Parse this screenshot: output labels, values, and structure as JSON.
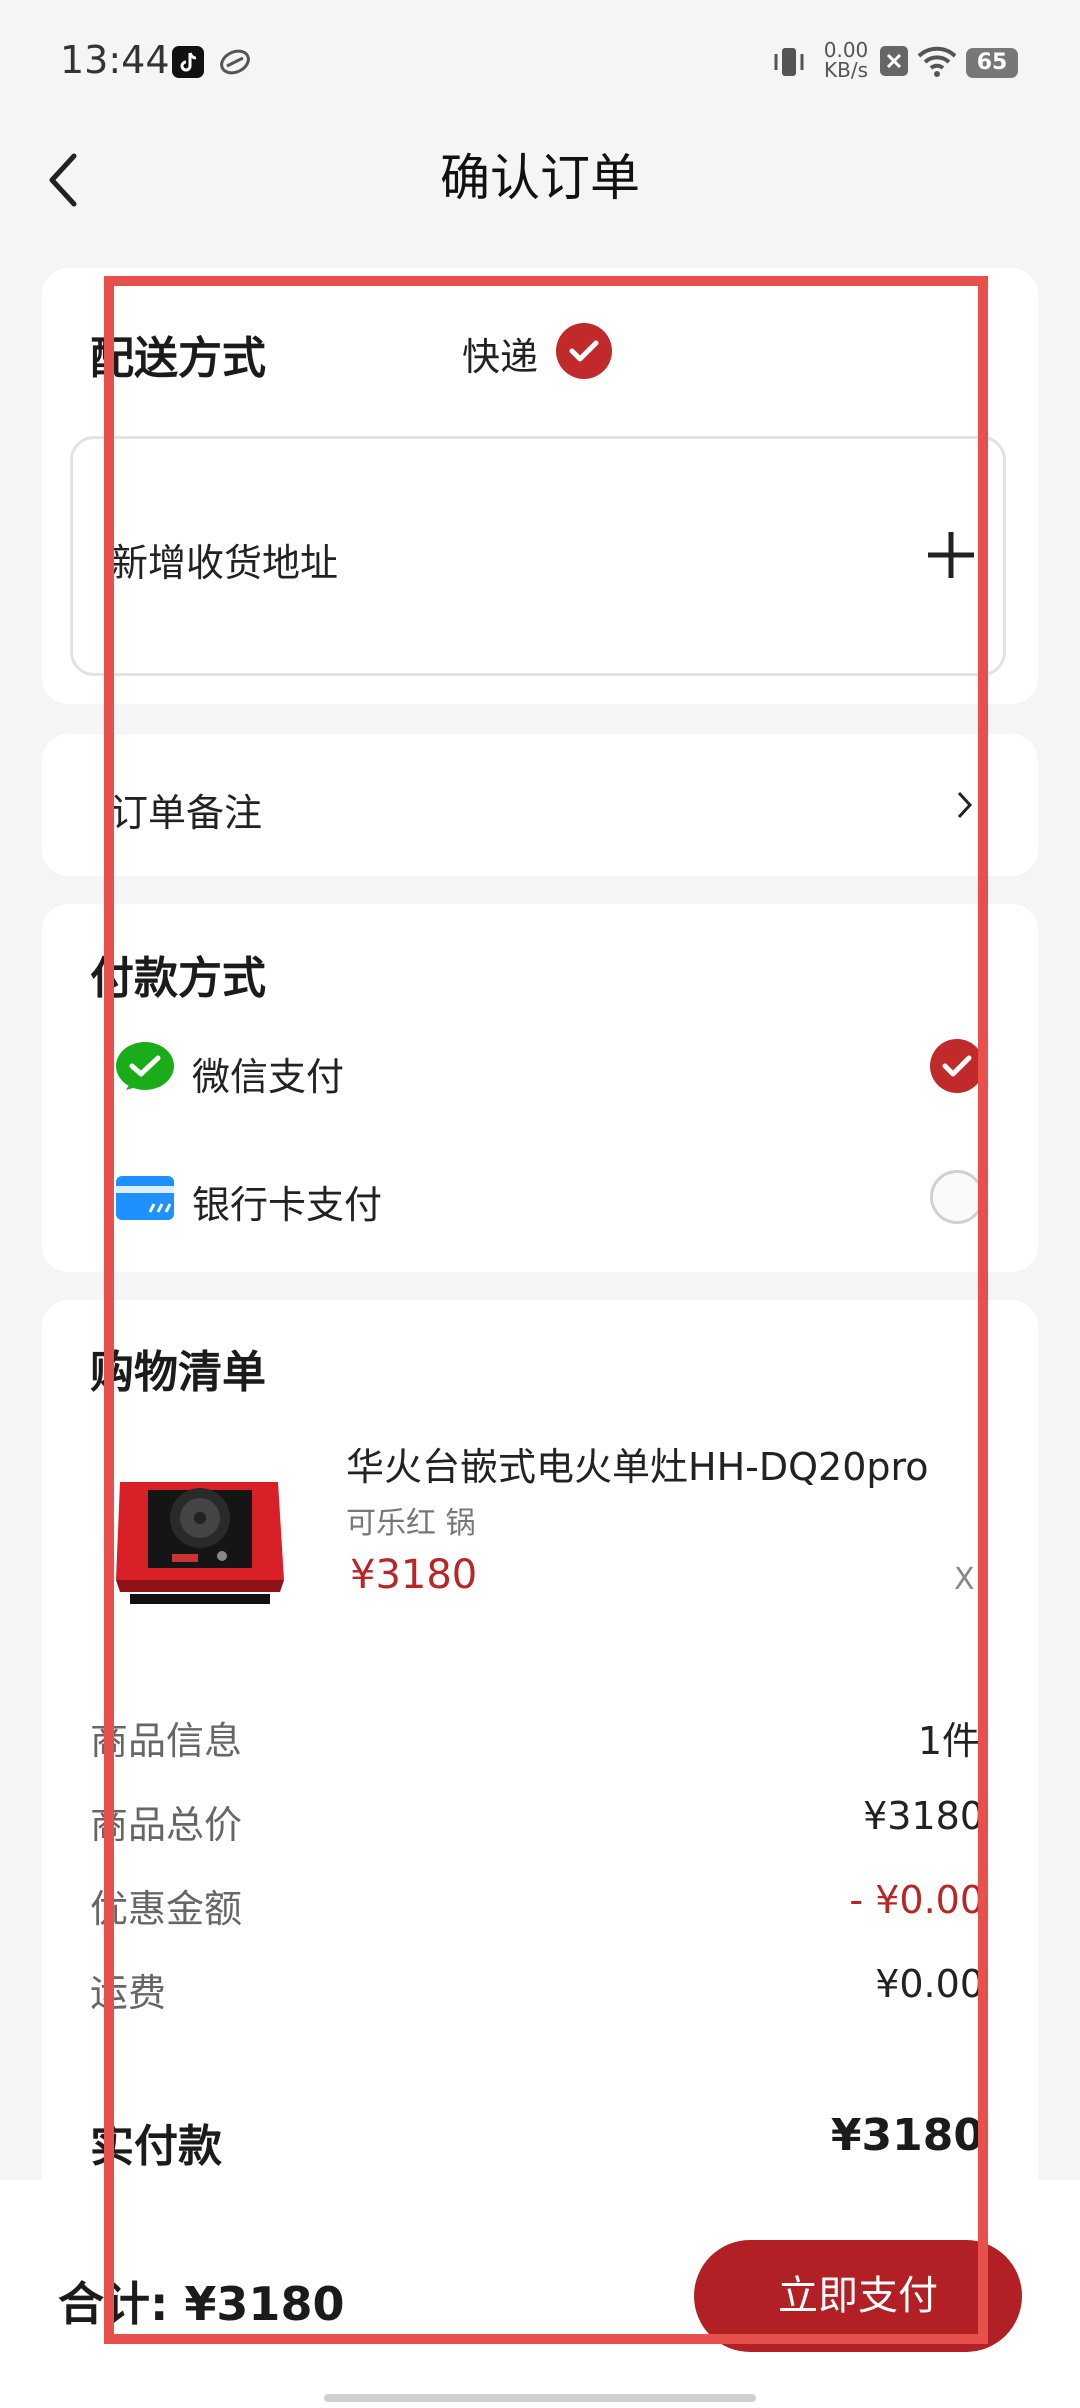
{
  "status_bar": {
    "time": "13:44",
    "net_speed_value": "0.00",
    "net_speed_unit": "KB/s",
    "battery": "65"
  },
  "nav": {
    "title": "确认订单"
  },
  "delivery": {
    "title": "配送方式",
    "option": "快递",
    "add_address": "新增收货地址"
  },
  "remark": {
    "label": "订单备注"
  },
  "payment": {
    "title": "付款方式",
    "wechat": "微信支付",
    "bank": "银行卡支付"
  },
  "cart": {
    "title": "购物清单",
    "product_name": "华火台嵌式电火单灶HH-DQ20pro",
    "product_variant": "可乐红 锅",
    "product_price": "¥3180",
    "product_qty": "X",
    "summary": [
      {
        "label": "商品信息",
        "value": "1件"
      },
      {
        "label": "商品总价",
        "value": "¥3180"
      },
      {
        "label": "优惠金额",
        "value": "- ¥0.00"
      },
      {
        "label": "运费",
        "value": "¥0.00"
      }
    ],
    "paid_label": "实付款",
    "paid_value": "¥3180"
  },
  "bottom": {
    "total_label": "合计:",
    "total_value": "¥3180",
    "pay_button": "立即支付"
  },
  "colors": {
    "accent": "#b21f24",
    "check": "#c02a2a",
    "overlay": "#e8504c",
    "wechat": "#1aad19",
    "bank": "#1e90ff"
  }
}
